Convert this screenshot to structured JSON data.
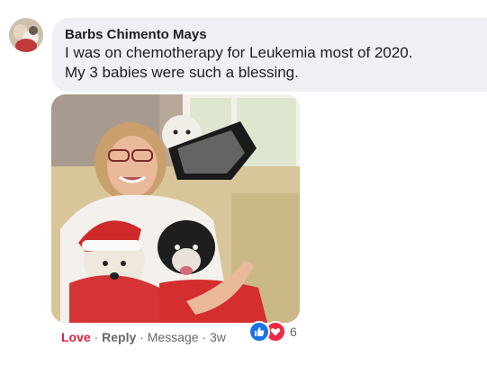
{
  "comment": {
    "author": "Barbs Chimento Mays",
    "text_line1": "I was on chemotherapy for Leukemia most of 2020.",
    "text_line2": "My 3 babies were such a blessing."
  },
  "actions": {
    "love_label": "Love",
    "separator": "·",
    "reply_label": "Reply",
    "message_label": "Message",
    "timestamp": "3w"
  },
  "reactions": {
    "icons": [
      "like-icon",
      "love-icon"
    ],
    "count": "6",
    "like_color": "#1b74e4",
    "love_color": "#f02849"
  },
  "colors": {
    "bubble_bg": "#eef0f3",
    "love_active": "#e41e3f",
    "meta_text": "#65676b"
  }
}
